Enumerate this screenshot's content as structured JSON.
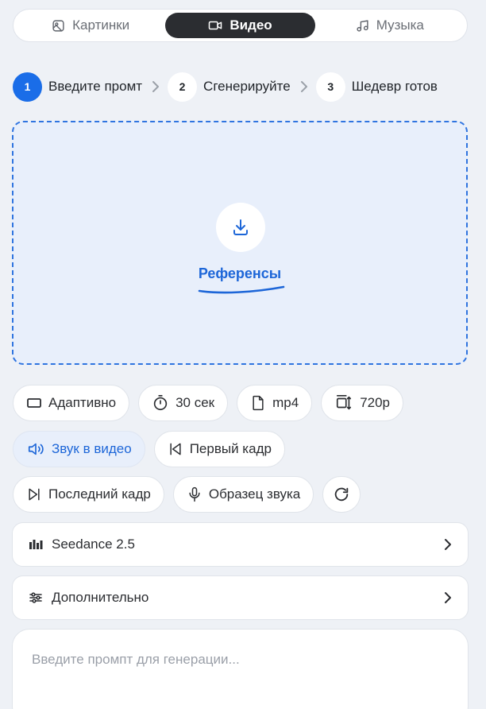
{
  "tabs": [
    {
      "label": "Картинки",
      "icon": "image-icon",
      "active": false
    },
    {
      "label": "Видео",
      "icon": "video-camera-icon",
      "active": true
    },
    {
      "label": "Музыка",
      "icon": "music-note-icon",
      "active": false
    }
  ],
  "steps": [
    {
      "num": "1",
      "label": "Введите промт",
      "active": true
    },
    {
      "num": "2",
      "label": "Сгенерируйте",
      "active": false
    },
    {
      "num": "3",
      "label": "Шедевр готов",
      "active": false
    }
  ],
  "upload": {
    "label": "Референсы",
    "icon": "download-icon"
  },
  "options": {
    "aspect": {
      "label": "Адаптивно",
      "icon": "rectangle-icon"
    },
    "duration": {
      "label": "30 сек",
      "icon": "timer-icon"
    },
    "format": {
      "label": "mp4",
      "icon": "file-icon"
    },
    "resolution": {
      "label": "720p",
      "icon": "resize-icon"
    },
    "sound": {
      "label": "Звук в видео",
      "icon": "speaker-icon",
      "active": true
    },
    "first_frame": {
      "label": "Первый кадр",
      "icon": "skip-back-icon"
    },
    "last_frame": {
      "label": "Последний кадр",
      "icon": "skip-forward-icon"
    },
    "voice_sample": {
      "label": "Образец звука",
      "icon": "microphone-icon"
    },
    "reset": {
      "icon": "refresh-icon"
    }
  },
  "model": {
    "label": "Seedance 2.5",
    "icon": "equalizer-icon"
  },
  "advanced": {
    "label": "Дополнительно",
    "icon": "sliders-icon"
  },
  "prompt": {
    "placeholder": "Введите промпт для генерации...",
    "value": ""
  },
  "colors": {
    "accent": "#1a6de8",
    "active_tab": "#2b2d31",
    "background": "#eef1f6"
  }
}
